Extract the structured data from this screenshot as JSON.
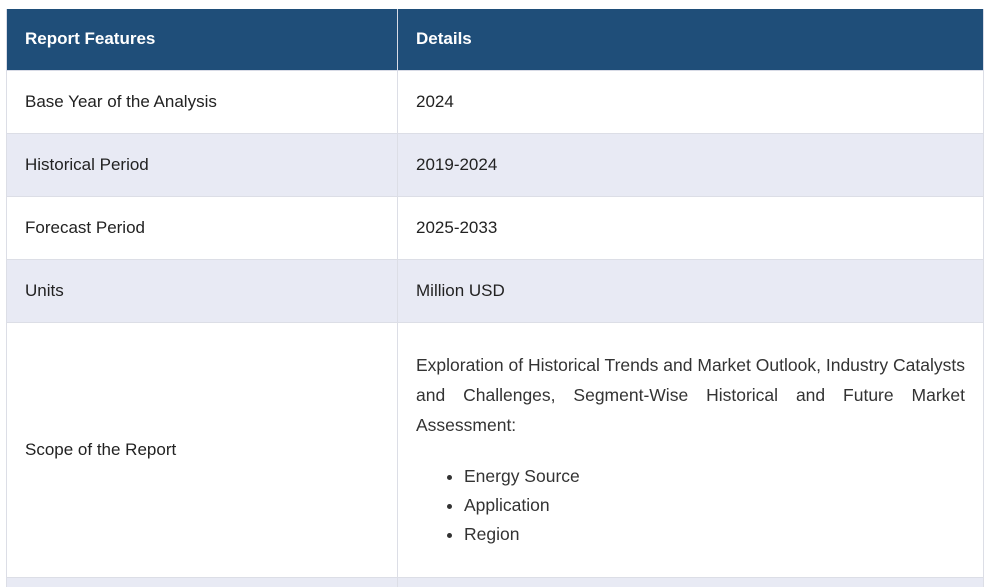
{
  "table": {
    "headers": [
      "Report Features",
      "Details"
    ],
    "rows": [
      {
        "feature": "Base Year of the Analysis",
        "detail": "2024"
      },
      {
        "feature": "Historical Period",
        "detail": "2019-2024"
      },
      {
        "feature": "Forecast Period",
        "detail": "2025-2033"
      },
      {
        "feature": "Units",
        "detail": "Million USD"
      }
    ],
    "scope": {
      "feature": "Scope of the Report",
      "text": "Exploration of Historical Trends and Market Outlook, Industry Catalysts and Challenges, Segment-Wise Historical and Future Market Assessment:",
      "items": [
        "Energy Source",
        "Application",
        "Region"
      ]
    }
  },
  "colors": {
    "header_bg": "#1f4e79",
    "alt_row_bg": "#e8eaf4",
    "border": "#dcdee6"
  }
}
